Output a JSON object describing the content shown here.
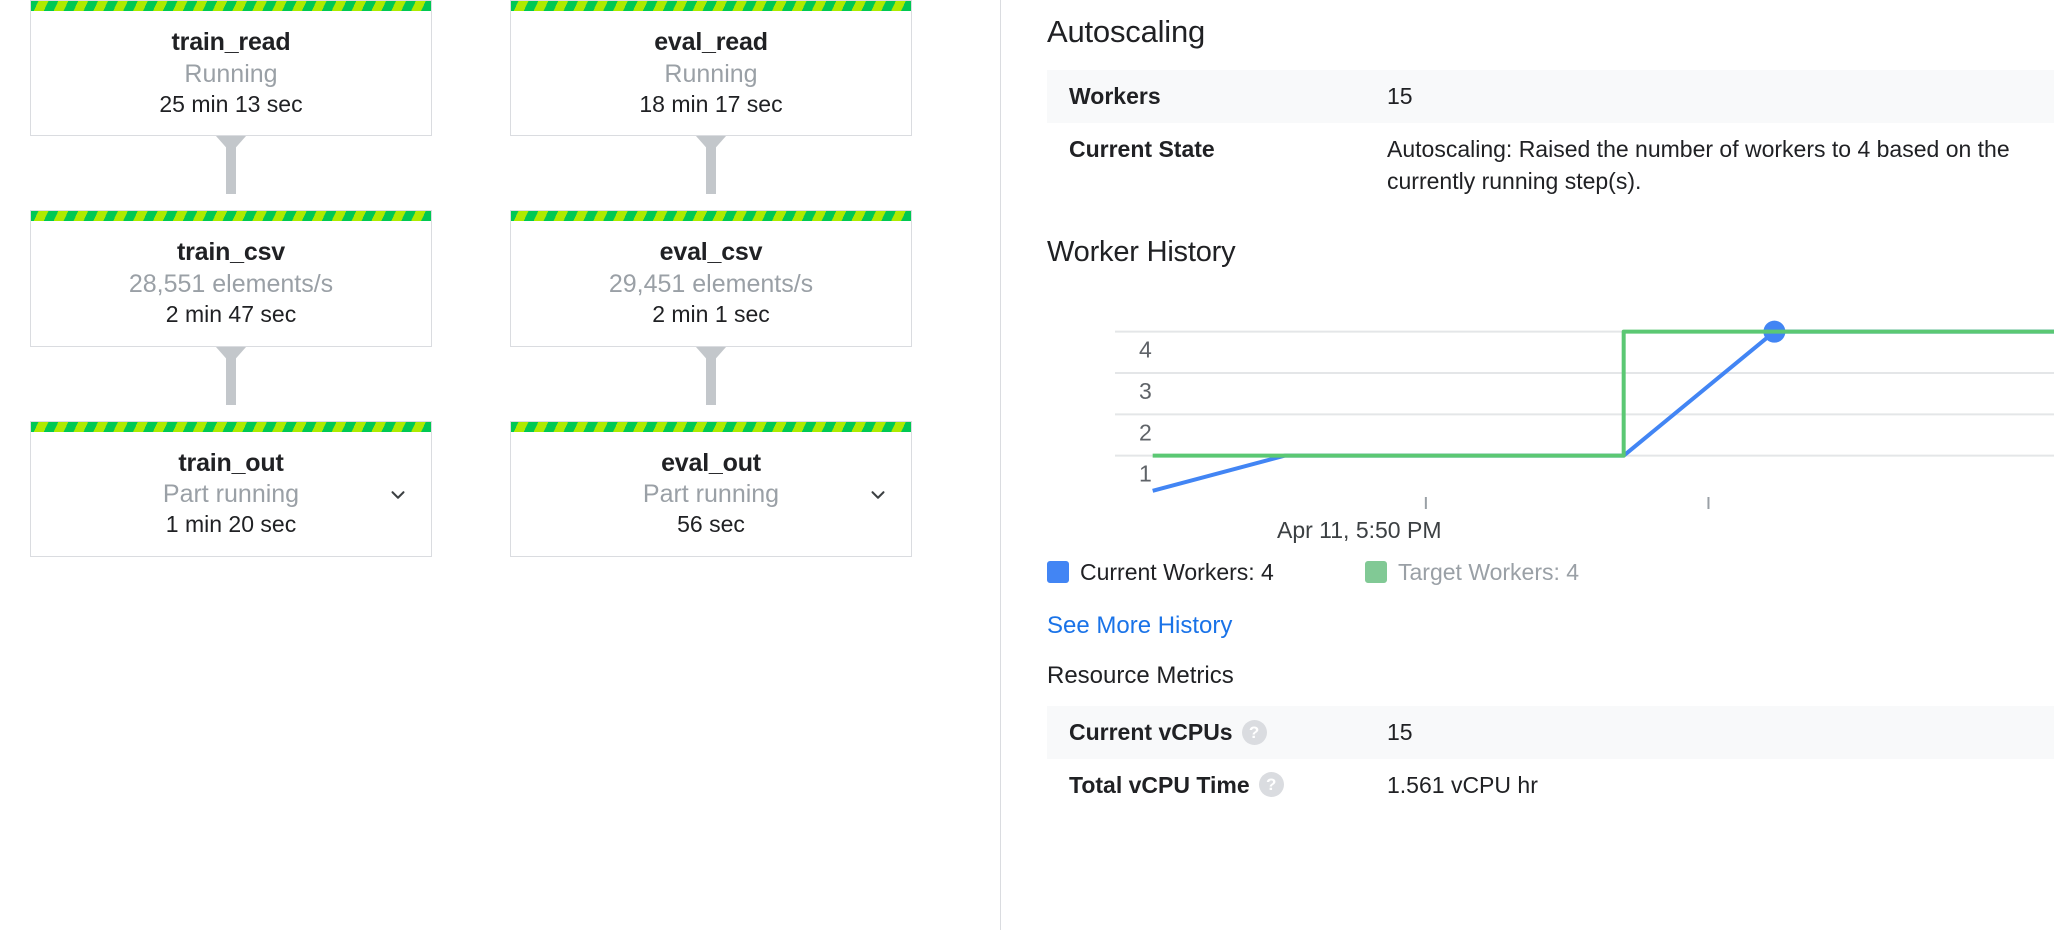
{
  "graph": {
    "columns": [
      {
        "id": "train",
        "nodes": [
          {
            "name": "train_read",
            "sub": "Running",
            "duration": "25 min 13 sec",
            "expandable": false
          },
          {
            "name": "train_csv",
            "sub": "28,551 elements/s",
            "duration": "2 min 47 sec",
            "expandable": false
          },
          {
            "name": "train_out",
            "sub": "Part running",
            "duration": "1 min 20 sec",
            "expandable": true
          }
        ]
      },
      {
        "id": "eval",
        "nodes": [
          {
            "name": "eval_read",
            "sub": "Running",
            "duration": "18 min 17 sec",
            "expandable": false
          },
          {
            "name": "eval_csv",
            "sub": "29,451 elements/s",
            "duration": "2 min 1 sec",
            "expandable": false
          },
          {
            "name": "eval_out",
            "sub": "Part running",
            "duration": "56 sec",
            "expandable": true
          }
        ]
      }
    ],
    "stripe_colors": {
      "green": "#00c853",
      "yellow_green": "#aeea00"
    }
  },
  "details": {
    "autoscaling": {
      "title": "Autoscaling",
      "rows": [
        {
          "key": "Workers",
          "value": "15"
        },
        {
          "key": "Current State",
          "value": "Autoscaling: Raised the number of workers to 4 based on the\ncurrently running step(s)."
        }
      ]
    },
    "worker_history": {
      "title": "Worker History",
      "see_more_label": "See More History",
      "legend": [
        {
          "label": "Current Workers: 4",
          "color": "#4285f4",
          "active": true
        },
        {
          "label": "Target Workers: 4",
          "color": "#81c995",
          "active": false
        }
      ]
    },
    "resource_metrics": {
      "title": "Resource Metrics",
      "rows": [
        {
          "key": "Current vCPUs",
          "value": "15",
          "help": "help-icon"
        },
        {
          "key": "Total vCPU Time",
          "value": "1.561 vCPU hr",
          "help": "help-icon"
        }
      ]
    }
  },
  "chart_data": {
    "type": "line",
    "title": "Worker History",
    "xlabel": "",
    "ylabel": "",
    "ylim": [
      0,
      4.5
    ],
    "yticks": [
      1,
      2,
      3,
      4
    ],
    "ytick_labels": [
      "1",
      "2",
      "3",
      "4"
    ],
    "xtick_labels": [
      "Apr 11, 5:50 PM"
    ],
    "grid": true,
    "legend_position": "bottom",
    "series": [
      {
        "name": "Target Workers",
        "color": "#5bc873",
        "style": "step",
        "points": [
          {
            "x": 0.04,
            "y": 1
          },
          {
            "x": 0.54,
            "y": 1
          },
          {
            "x": 0.54,
            "y": 4
          },
          {
            "x": 1.0,
            "y": 4
          }
        ]
      },
      {
        "name": "Current Workers",
        "color": "#4285f4",
        "style": "line",
        "marker_at": {
          "x": 0.7,
          "y": 4
        },
        "points": [
          {
            "x": 0.04,
            "y": 0.15
          },
          {
            "x": 0.18,
            "y": 1
          },
          {
            "x": 0.54,
            "y": 1
          },
          {
            "x": 0.7,
            "y": 4
          },
          {
            "x": 1.0,
            "y": 4
          }
        ]
      }
    ]
  }
}
